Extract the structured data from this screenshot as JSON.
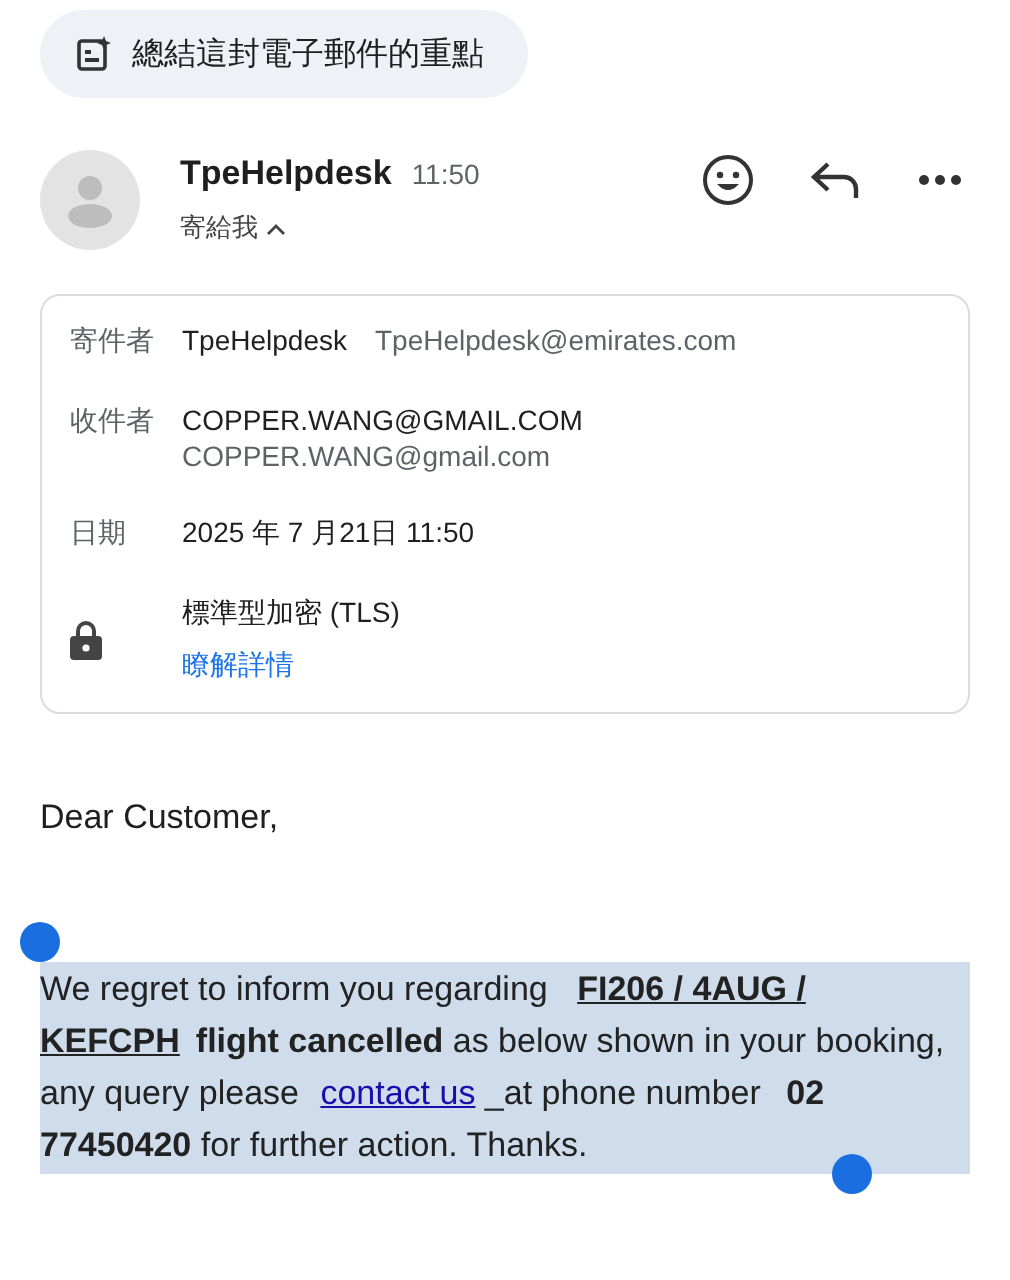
{
  "summary_chip": {
    "label": "總結這封電子郵件的重點"
  },
  "header": {
    "sender": "TpeHelpdesk",
    "time": "11:50",
    "recipient_toggle": "寄給我",
    "expanded": true
  },
  "details": [
    {
      "kind": "from",
      "label": "寄件者",
      "name": "TpeHelpdesk",
      "email": "TpeHelpdesk@emirates.com"
    },
    {
      "kind": "to",
      "label": "收件者",
      "name": "COPPER.WANG@GMAIL.COM",
      "email": "COPPER.WANG@gmail.com"
    },
    {
      "kind": "date",
      "label": "日期",
      "value": "2025 年 7 月21日 11:50"
    },
    {
      "kind": "security",
      "value": "標準型加密 (TLS)",
      "link": "瞭解詳情"
    }
  ],
  "body": {
    "greeting": "Dear Customer,",
    "selected": true,
    "segments": [
      {
        "kind": "plain",
        "text": "We regret to inform you regarding "
      },
      {
        "kind": "strong_underline",
        "text": "FI206 / 4AUG / KEFCPH"
      },
      {
        "kind": "strong",
        "text": "flight cancelled"
      },
      {
        "kind": "plain",
        "text": " as below shown in your booking, any query please "
      },
      {
        "kind": "link",
        "text": "contact us"
      },
      {
        "kind": "plain",
        "text": " _at phone number "
      },
      {
        "kind": "strong",
        "text": "02 77450420"
      },
      {
        "kind": "plain",
        "text": " for further action. Thanks."
      }
    ]
  }
}
